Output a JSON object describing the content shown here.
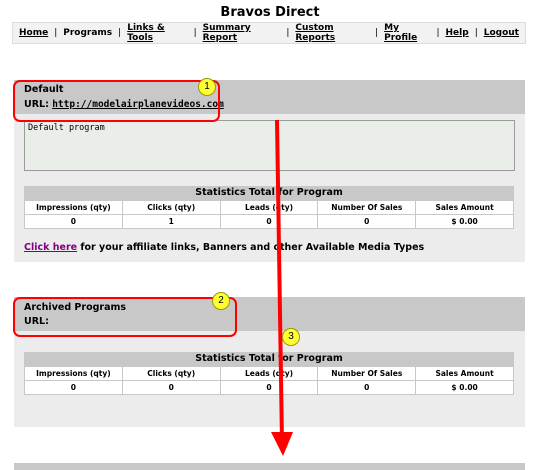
{
  "app": {
    "title": "Bravos Direct"
  },
  "nav": {
    "items": [
      "Home",
      "Programs",
      "Links & Tools",
      "Summary Report",
      "Custom Reports",
      "My Profile",
      "Help",
      "Logout"
    ]
  },
  "default_program": {
    "name": "Default",
    "url_label": "URL:",
    "url": "http://modelairplanevideos.com",
    "description": "Default program"
  },
  "stats": {
    "title": "Statistics Total for Program",
    "headers": [
      "Impressions (qty)",
      "Clicks (qty)",
      "Leads (qty)",
      "Number Of Sales",
      "Sales Amount"
    ],
    "default_row": [
      "0",
      "1",
      "0",
      "0",
      "$ 0.00"
    ],
    "archived_row": [
      "0",
      "0",
      "0",
      "0",
      "$ 0.00"
    ]
  },
  "affiliate_link": {
    "link_text": "Click here",
    "rest": " for your affiliate links, Banners and other Available Media Types"
  },
  "archived": {
    "name": "Archived Programs",
    "url_label": "URL:"
  },
  "callouts": [
    "1",
    "2",
    "3"
  ],
  "colors": {
    "callout": "#ff0000",
    "arrow": "#ff0000",
    "badge": "#ffff33"
  }
}
